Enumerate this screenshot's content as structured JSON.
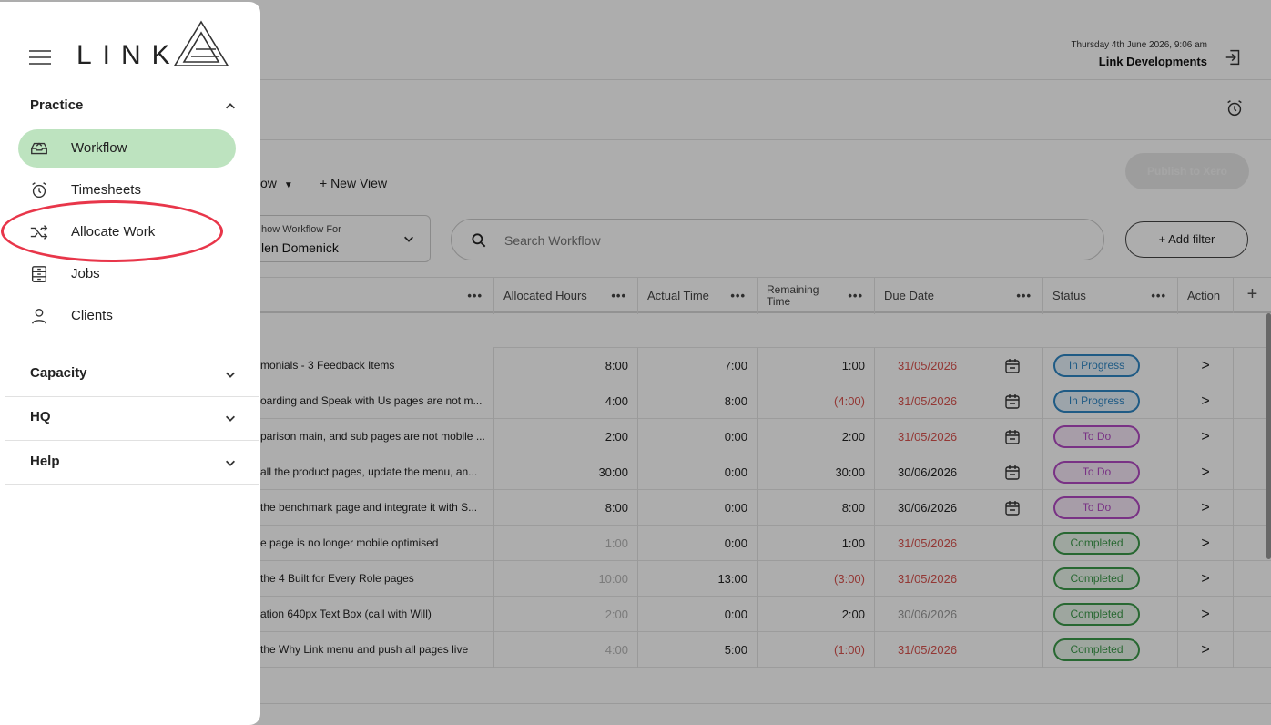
{
  "header": {
    "datetime": "Thursday 4th June 2026, 9:06 am",
    "organisation": "Link Developments"
  },
  "toolbar": {
    "view_label": "ow",
    "new_view_label": "+ New View",
    "publish_label": "Publish to Xero",
    "show_for_label": "how Workflow For",
    "show_for_value": "len Domenick",
    "search_placeholder": "Search Workflow",
    "add_filter_label": "+ Add filter"
  },
  "table": {
    "columns": {
      "allocated": "Allocated Hours",
      "actual": "Actual Time",
      "remaining": "Remaining Time",
      "due": "Due Date",
      "status": "Status",
      "action": "Action",
      "add": "+",
      "more": "•••"
    },
    "rows": [
      {
        "name": "monials - 3 Feedback Items",
        "alloc": "8:00",
        "actual": "7:00",
        "remaining": "1:00",
        "due": "31/05/2026",
        "status": "In Progress",
        "action": ">"
      },
      {
        "name": "oarding and Speak with Us pages are not m...",
        "alloc": "4:00",
        "actual": "8:00",
        "remaining": "(4:00)",
        "due": "31/05/2026",
        "status": "In Progress",
        "action": ">"
      },
      {
        "name": "parison main, and sub pages are not mobile ...",
        "alloc": "2:00",
        "actual": "0:00",
        "remaining": "2:00",
        "due": "31/05/2026",
        "status": "To Do",
        "action": ">"
      },
      {
        "name": "all the product pages, update the menu, an...",
        "alloc": "30:00",
        "actual": "0:00",
        "remaining": "30:00",
        "due": "30/06/2026",
        "status": "To Do",
        "action": ">"
      },
      {
        "name": "the benchmark page and integrate it with S...",
        "alloc": "8:00",
        "actual": "0:00",
        "remaining": "8:00",
        "due": "30/06/2026",
        "status": "To Do",
        "action": ">"
      },
      {
        "name": "e page is no longer mobile optimised",
        "alloc": "1:00",
        "actual": "0:00",
        "remaining": "1:00",
        "due": "31/05/2026",
        "status": "Completed",
        "action": ">"
      },
      {
        "name": "the 4 Built for Every Role pages",
        "alloc": "10:00",
        "actual": "13:00",
        "remaining": "(3:00)",
        "due": "31/05/2026",
        "status": "Completed",
        "action": ">"
      },
      {
        "name": "ation 640px Text Box (call with Will)",
        "alloc": "2:00",
        "actual": "0:00",
        "remaining": "2:00",
        "due": "30/06/2026",
        "status": "Completed",
        "action": ">"
      },
      {
        "name": "the Why Link menu and push all pages live",
        "alloc": "4:00",
        "actual": "5:00",
        "remaining": "(1:00)",
        "due": "31/05/2026",
        "status": "Completed",
        "action": ">"
      }
    ]
  },
  "sidebar": {
    "logo_text": "LINK",
    "sections": {
      "practice": "Practice",
      "capacity": "Capacity",
      "hq": "HQ",
      "help": "Help"
    },
    "items": [
      {
        "label": "Workflow",
        "icon": "inbox-tray-icon"
      },
      {
        "label": "Timesheets",
        "icon": "alarm-clock-icon"
      },
      {
        "label": "Allocate Work",
        "icon": "shuffle-icon"
      },
      {
        "label": "Jobs",
        "icon": "stack-icon"
      },
      {
        "label": "Clients",
        "icon": "person-icon"
      }
    ]
  },
  "colors": {
    "active_item": "#bde3bf",
    "annotation": "#e8364a",
    "negative": "#d9534f",
    "in_progress": "#2f86c4",
    "to_do": "#b34bc4",
    "completed": "#3c9a4a"
  }
}
